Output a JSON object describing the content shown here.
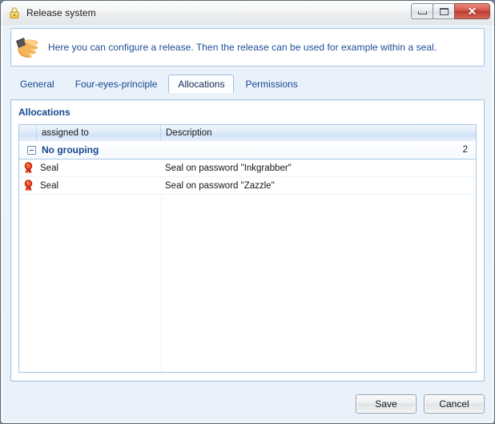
{
  "window": {
    "title": "Release system",
    "lock_icon": "lock-icon",
    "caption": {
      "minimize": "minimize-button",
      "maximize": "maximize-button",
      "close_label": "✕"
    }
  },
  "info": {
    "icon": "hand-pointing-icon",
    "text": "Here you can configure a release. Then the release can be used for example within a seal."
  },
  "tabs": [
    {
      "label": "General",
      "selected": false
    },
    {
      "label": "Four-eyes-principle",
      "selected": false
    },
    {
      "label": "Allocations",
      "selected": true
    },
    {
      "label": "Permissions",
      "selected": false
    }
  ],
  "page": {
    "section_title": "Allocations"
  },
  "grid": {
    "columns": [
      {
        "label": "assigned to"
      },
      {
        "label": "Description"
      }
    ],
    "group": {
      "expander_icon": "collapse-minus-icon",
      "label": "No grouping",
      "count": "2"
    },
    "rows": [
      {
        "icon": "seal-icon",
        "assigned_to": "Seal",
        "description": "Seal on password \"Inkgrabber\""
      },
      {
        "icon": "seal-icon",
        "assigned_to": "Seal",
        "description": "Seal on password \"Zazzle\""
      }
    ]
  },
  "footer": {
    "save_label": "Save",
    "cancel_label": "Cancel"
  },
  "colors": {
    "accent_blue": "#15488f",
    "panel_border": "#9cc0de",
    "client_background": "#e9f1fa",
    "close_button_red": "#d4564a",
    "seal_red": "#e03a18",
    "lock_gold": "#ecc23c"
  }
}
